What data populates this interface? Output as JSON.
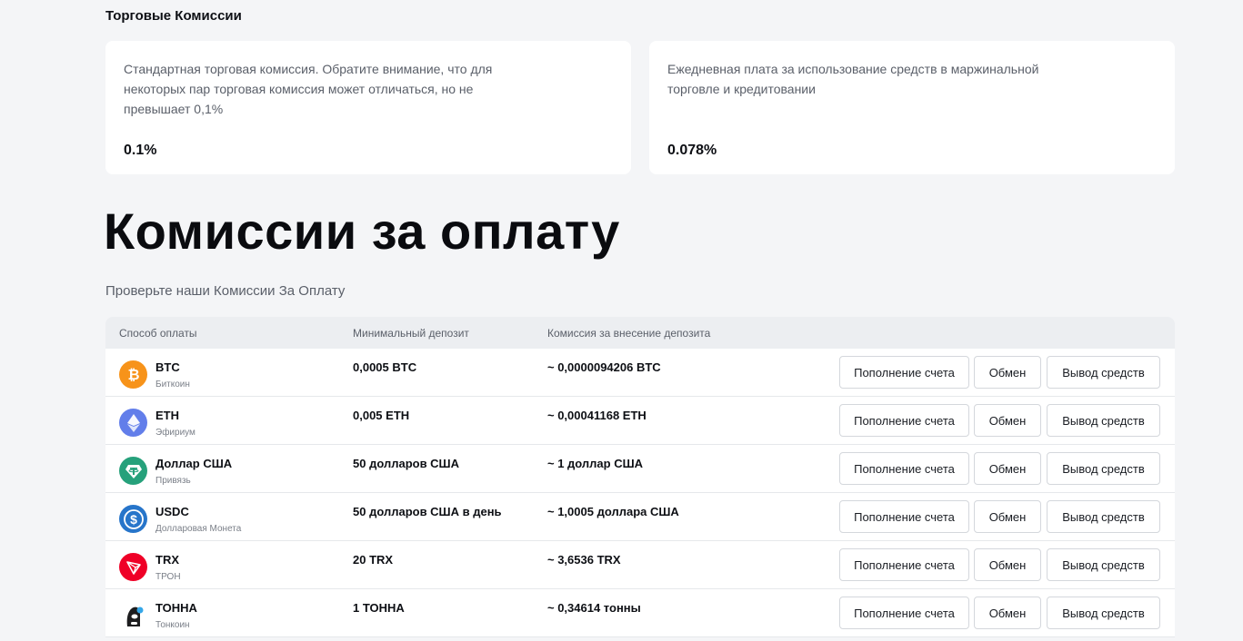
{
  "trading": {
    "title": "Торговые Комиссии",
    "cards": [
      {
        "description": "Стандартная торговая комиссия. Обратите внимание, что для некоторых пар торговая комиссия может отличаться, но не превышает 0,1%",
        "value": "0.1%"
      },
      {
        "description": "Ежедневная плата за использование средств в маржинальной торговле и кредитовании",
        "value": "0.078%"
      }
    ]
  },
  "payment": {
    "title": "Комиссии за оплату",
    "subtitle": "Проверьте наши Комиссии За Оплату",
    "headers": {
      "method": "Способ оплаты",
      "min_deposit": "Минимальный депозит",
      "deposit_fee": "Комиссия за внесение депозита"
    },
    "buttons": {
      "deposit": "Пополнение счета",
      "exchange": "Обмен",
      "withdraw": "Вывод средств"
    },
    "rows": [
      {
        "name": "BTC",
        "sub": "Биткоин",
        "min": "0,0005 BTC",
        "fee": "~ 0,0000094206 BTC",
        "icon": "bitcoin-icon",
        "color": "#f7931a"
      },
      {
        "name": "ETH",
        "sub": "Эфириум",
        "min": "0,005 ETH",
        "fee": "~ 0,00041168 ETH",
        "icon": "ethereum-icon",
        "color": "#627eea"
      },
      {
        "name": "Доллар США",
        "sub": "Привязь",
        "min": "50 долларов США",
        "fee": "~ 1 доллар США",
        "icon": "tether-icon",
        "color": "#26a17b"
      },
      {
        "name": "USDC",
        "sub": "Долларовая Монета",
        "min": "50 долларов США в день",
        "fee": "~ 1,0005 доллара США",
        "icon": "usdc-icon",
        "color": "#2775ca"
      },
      {
        "name": "TRX",
        "sub": "ТРОН",
        "min": "20 TRX",
        "fee": "~ 3,6536 TRX",
        "icon": "tron-icon",
        "color": "#ef0027"
      },
      {
        "name": "ТОННА",
        "sub": "Тонкоин",
        "min": "1 ТОННА",
        "fee": "~ 0,34614 тонны",
        "icon": "toncoin-icon",
        "color": "#1d1d1f"
      }
    ]
  }
}
